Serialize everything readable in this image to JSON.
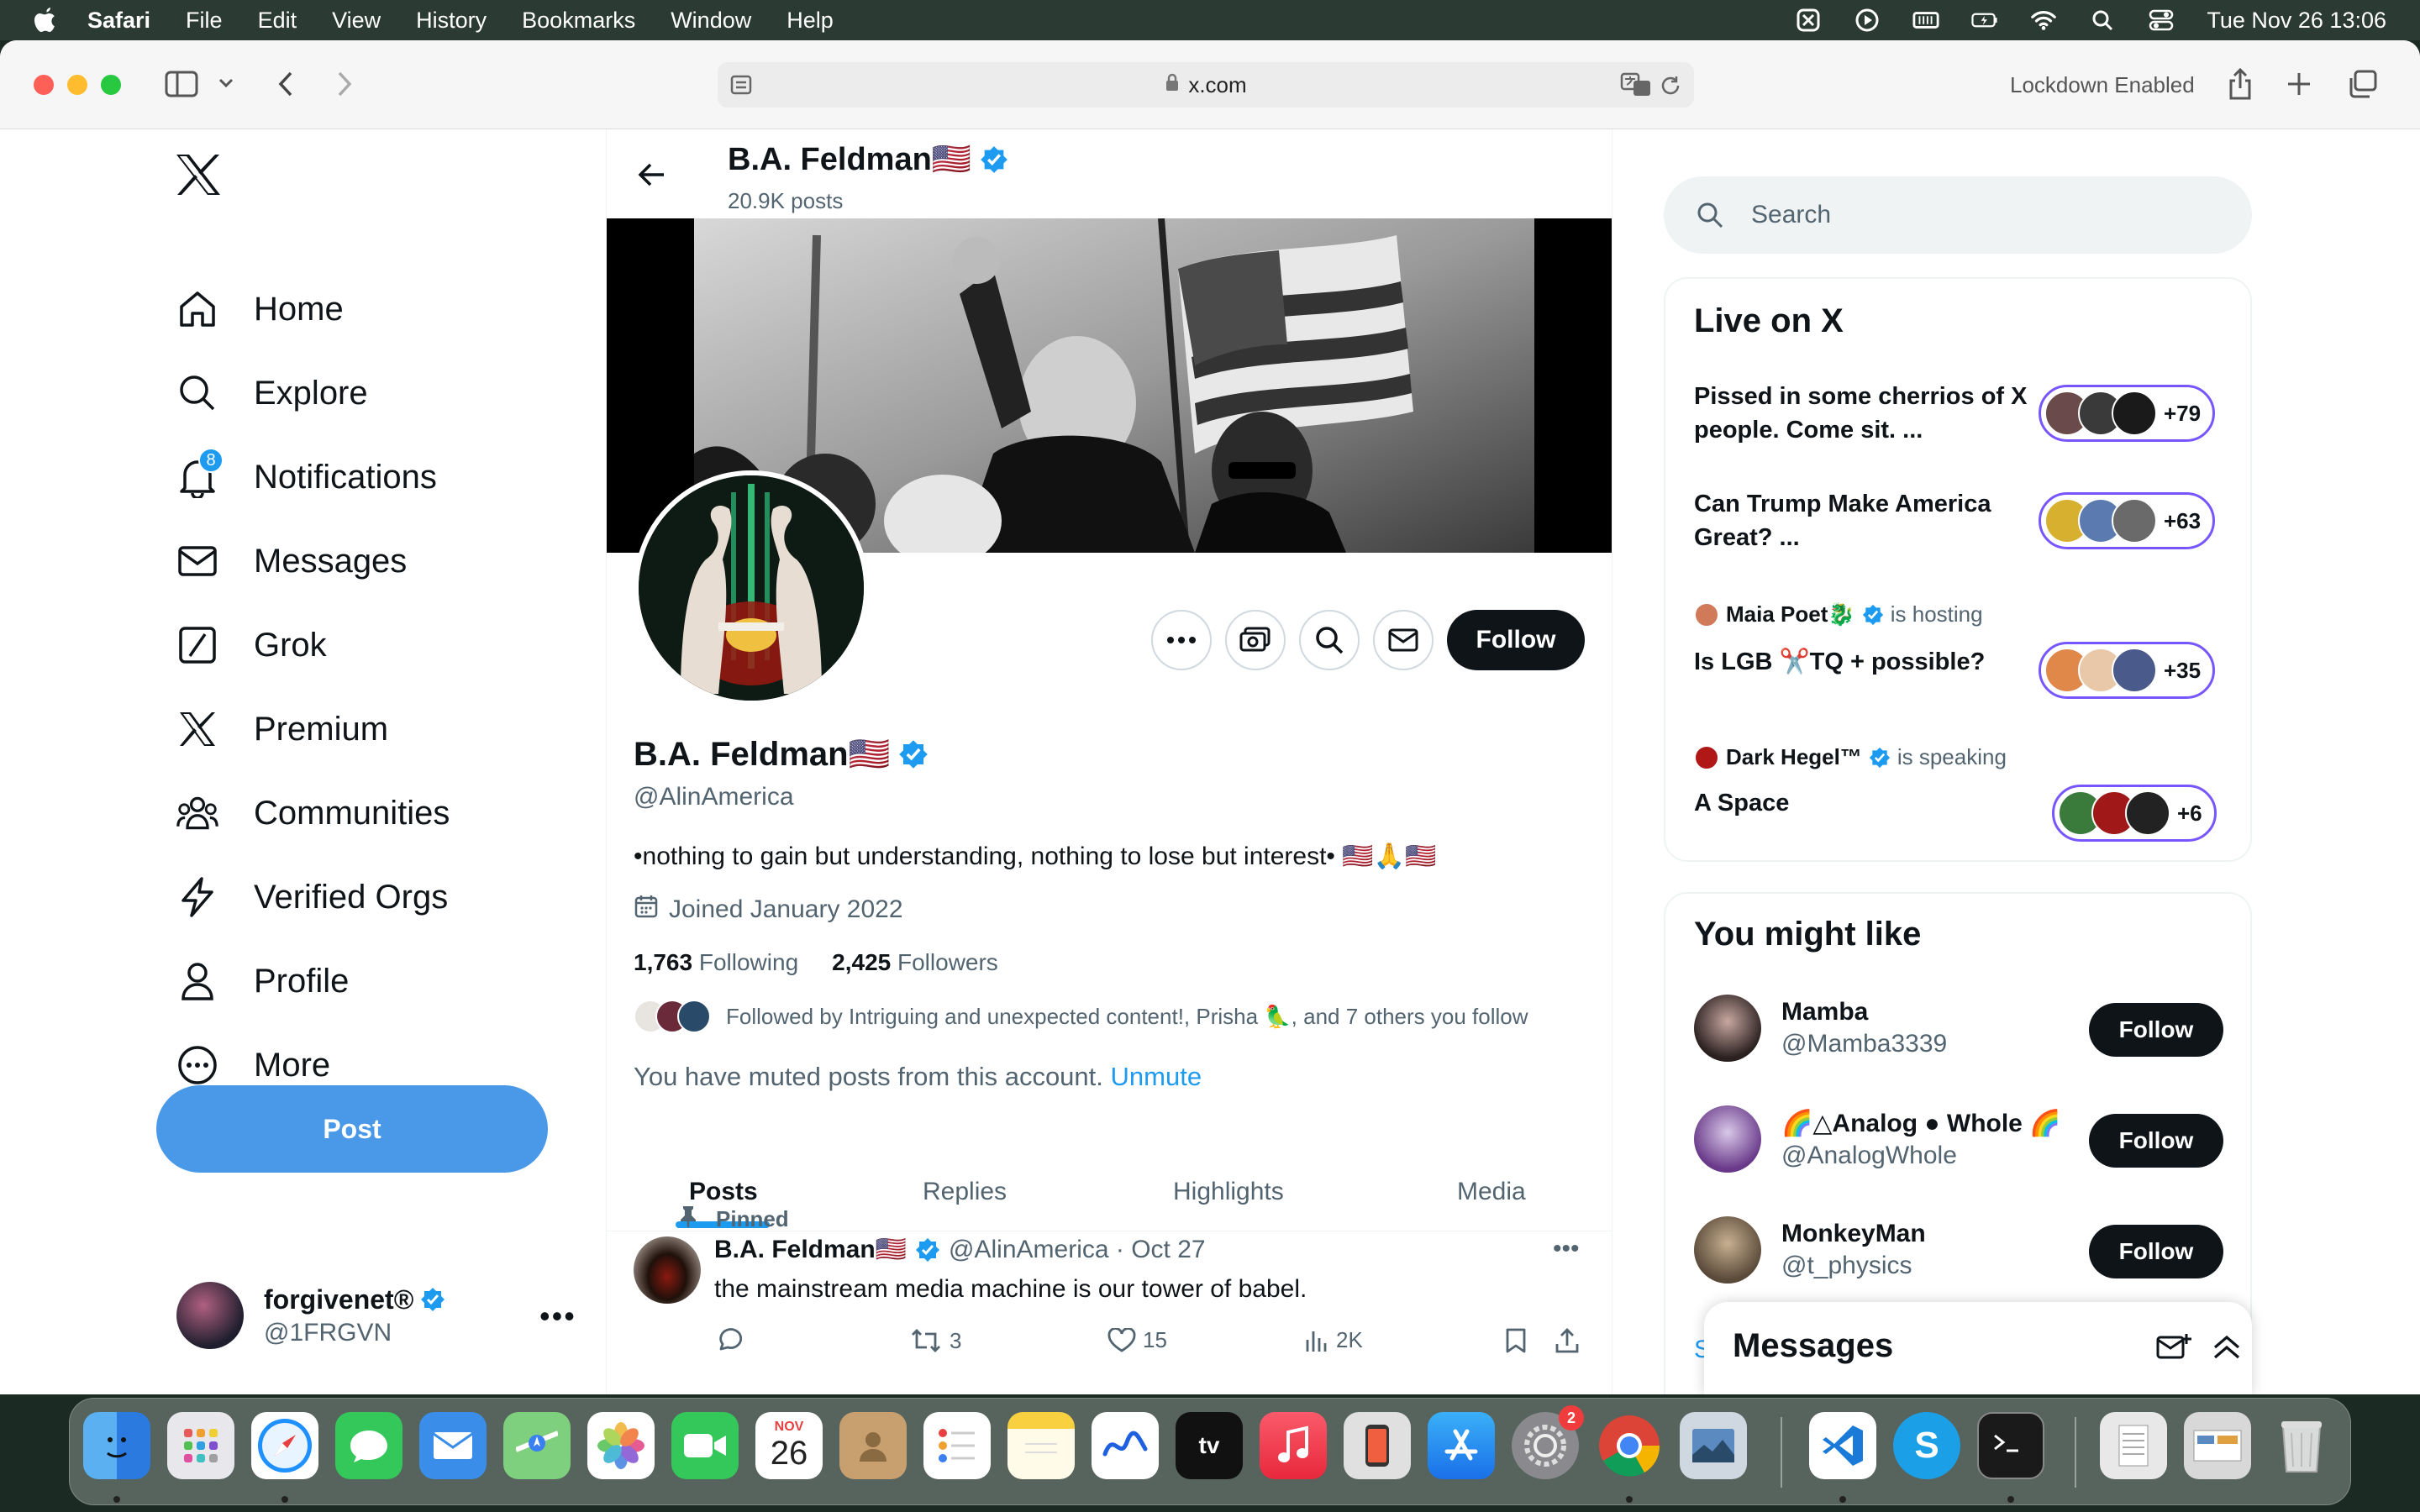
{
  "menubar": {
    "app": "Safari",
    "items": [
      "File",
      "Edit",
      "View",
      "History",
      "Bookmarks",
      "Window",
      "Help"
    ],
    "clock": "Tue Nov 26  13:06"
  },
  "browser": {
    "url": "x.com",
    "lockdown": "Lockdown Enabled"
  },
  "nav": {
    "items": [
      {
        "label": "Home",
        "icon": "home-icon"
      },
      {
        "label": "Explore",
        "icon": "search-icon"
      },
      {
        "label": "Notifications",
        "icon": "bell-icon",
        "badge": "8"
      },
      {
        "label": "Messages",
        "icon": "envelope-icon"
      },
      {
        "label": "Grok",
        "icon": "grok-icon"
      },
      {
        "label": "Premium",
        "icon": "x-icon"
      },
      {
        "label": "Communities",
        "icon": "people-icon"
      },
      {
        "label": "Verified Orgs",
        "icon": "lightning-icon"
      },
      {
        "label": "Profile",
        "icon": "person-icon"
      },
      {
        "label": "More",
        "icon": "more-circle-icon"
      }
    ],
    "post_label": "Post",
    "me": {
      "name": "forgivenet®",
      "handle": "@1FRGVN"
    }
  },
  "profile": {
    "header_name": "B.A. Feldman🇺🇸",
    "header_posts": "20.9K posts",
    "name": "B.A. Feldman🇺🇸",
    "handle": "@AlinAmerica",
    "bio": "•nothing to gain but understanding, nothing to lose but interest• 🇺🇸🙏🇺🇸",
    "joined": "Joined January 2022",
    "following_count": "1,763",
    "following_label": "Following",
    "followers_count": "2,425",
    "followers_label": "Followers",
    "followed_by": "Followed by Intriguing and unexpected content!, Prisha 🦜, and 7 others you follow",
    "muted_text": "You have muted posts from this account.",
    "unmute": "Unmute",
    "follow_label": "Follow"
  },
  "tabs": [
    "Posts",
    "Replies",
    "Highlights",
    "Media"
  ],
  "pinned_post": {
    "pinned_label": "Pinned",
    "name": "B.A. Feldman🇺🇸",
    "handle_date": "@AlinAmerica · Oct 27",
    "text": "the mainstream media machine is our tower of babel.",
    "retweets": "3",
    "likes": "15",
    "views": "2K"
  },
  "search": {
    "placeholder": "Search"
  },
  "live": {
    "title": "Live on X",
    "spaces": [
      {
        "title": "Pissed in some cherrios of X people. Come sit. ...",
        "count": "+79"
      },
      {
        "title": "Can Trump Make America Great? ...",
        "count": "+63"
      },
      {
        "host": "Maia Poet🐉",
        "status": "is hosting",
        "title": "Is LGB ✂️TQ + possible?",
        "count": "+35"
      },
      {
        "host": "Dark Hegel™",
        "status": "is speaking",
        "title": "A Space",
        "count": "+6"
      }
    ]
  },
  "wtf": {
    "title": "You might like",
    "users": [
      {
        "name": "Mamba",
        "handle": "@Mamba3339"
      },
      {
        "name": "🌈△Analog ● Whole 🌈",
        "handle": "@AnalogWhole"
      },
      {
        "name": "MonkeyMan",
        "handle": "@t_physics"
      }
    ],
    "follow_label": "Follow",
    "show_more": "Sh"
  },
  "messages_drawer": {
    "title": "Messages"
  },
  "dock": {
    "calendar_month": "NOV",
    "calendar_day": "26",
    "settings_badge": "2"
  },
  "colors": {
    "accent": "#1d9bf0",
    "post_button": "#4a99e9",
    "space_border": "#7856ff",
    "text": "#0f1419",
    "muted": "#536471"
  }
}
